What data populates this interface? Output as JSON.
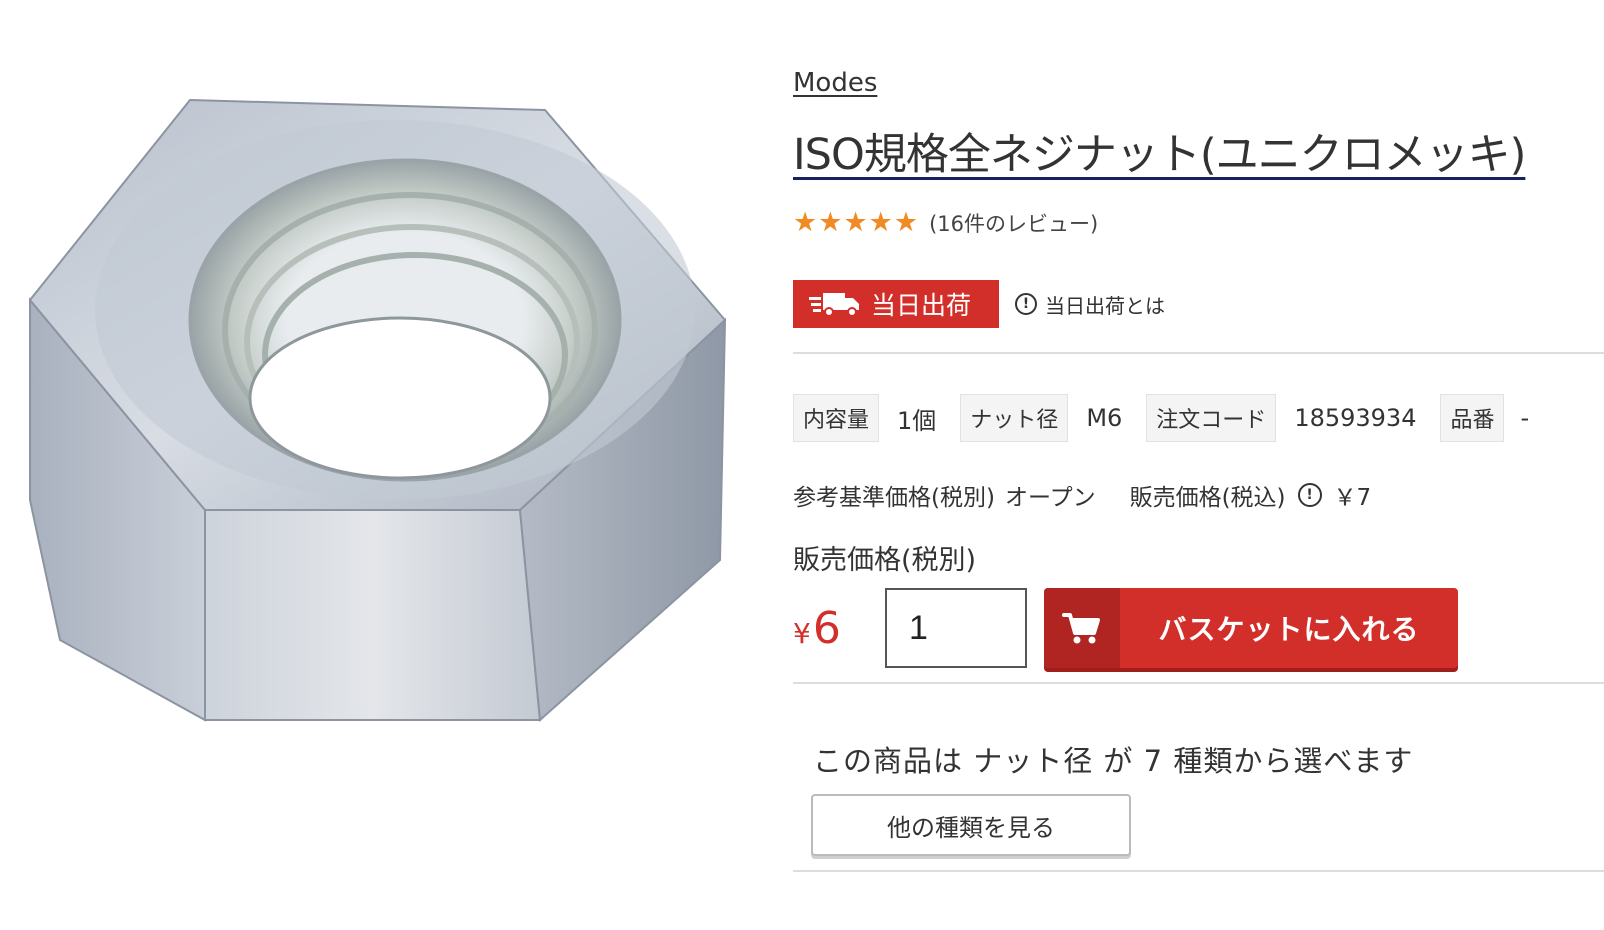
{
  "product": {
    "brand": "Modes",
    "title": "ISO規格全ネジナット(ユニクロメッキ)",
    "rating": 5,
    "review_count_text": "(16件のレビュー)"
  },
  "shipping": {
    "badge_label": "当日出荷",
    "help_label": "当日出荷とは"
  },
  "specs": [
    {
      "label": "内容量",
      "value": "1個"
    },
    {
      "label": "ナット径",
      "value": "M6"
    },
    {
      "label": "注文コード",
      "value": "18593934"
    },
    {
      "label": "品番",
      "value": "-"
    }
  ],
  "pricing": {
    "reference_label": "参考基準価格(税別)",
    "reference_value": "オープン",
    "sale_tax_incl_label": "販売価格(税込)",
    "sale_tax_incl_value": "￥7",
    "sale_tax_excl_label": "販売価格(税別)",
    "yen_symbol": "¥",
    "price_value": "6"
  },
  "purchase": {
    "quantity": "1",
    "cart_button_label": "バスケットに入れる"
  },
  "variants": {
    "text": "この商品は ナット径 が 7 種類から選べます",
    "button_label": "他の種類を見る"
  },
  "colors": {
    "accent_red": "#d32f2a",
    "star_orange": "#f08a24"
  }
}
